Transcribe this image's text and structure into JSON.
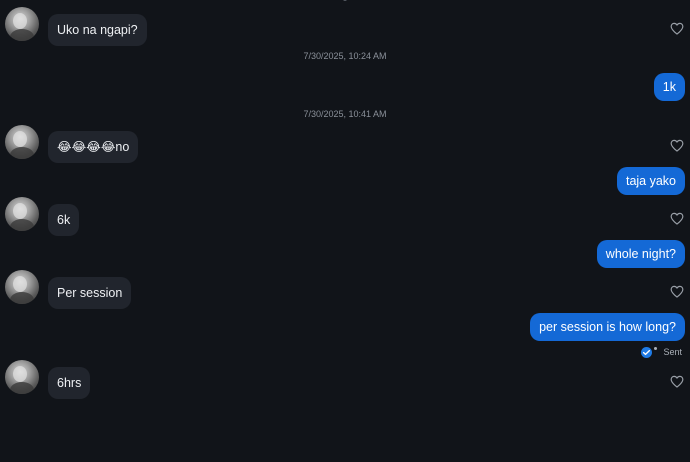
{
  "messages": [
    {
      "kind": "in",
      "text": "Uko na ngapi?"
    },
    {
      "kind": "timestamp",
      "text": "7/30/2025, 10:24 AM"
    },
    {
      "kind": "out",
      "text": "1k"
    },
    {
      "kind": "timestamp",
      "text": "7/30/2025, 10:41 AM"
    },
    {
      "kind": "in",
      "text": "😂😂😂😂no"
    },
    {
      "kind": "out",
      "text": "taja yako"
    },
    {
      "kind": "in",
      "text": "6k"
    },
    {
      "kind": "out",
      "text": "whole night?"
    },
    {
      "kind": "in",
      "text": "Per session"
    },
    {
      "kind": "out",
      "text": "per session is how long?"
    },
    {
      "kind": "in",
      "text": "6hrs"
    }
  ],
  "status": {
    "label": "Sent",
    "icon": "check-circle-icon"
  },
  "colors": {
    "background": "#111419",
    "incoming_bubble": "#21252d",
    "outgoing_bubble": "#1469d6",
    "timestamp_text": "#8a9099"
  }
}
